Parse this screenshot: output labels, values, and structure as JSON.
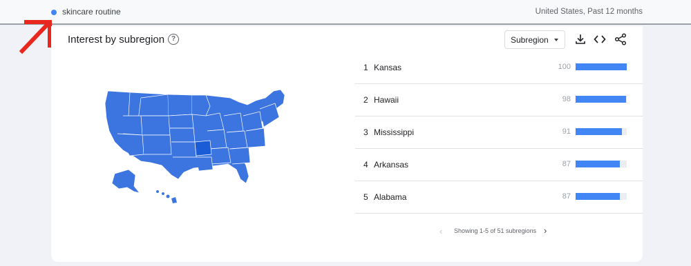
{
  "header": {
    "term": "skincare routine",
    "filters": "United States, Past 12 months",
    "term_color": "#4285f4"
  },
  "card": {
    "title": "Interest by subregion",
    "resolution_select": "Subregion",
    "icons": [
      "help-icon",
      "download-icon",
      "embed-icon",
      "share-icon"
    ]
  },
  "rankings": [
    {
      "rank": "1",
      "name": "Kansas",
      "value": "100",
      "fill": 1.0
    },
    {
      "rank": "2",
      "name": "Hawaii",
      "value": "98",
      "fill": 0.98
    },
    {
      "rank": "3",
      "name": "Mississippi",
      "value": "91",
      "fill": 0.91
    },
    {
      "rank": "4",
      "name": "Arkansas",
      "value": "87",
      "fill": 0.87
    },
    {
      "rank": "5",
      "name": "Alabama",
      "value": "87",
      "fill": 0.87
    }
  ],
  "pagination": {
    "text": "Showing 1-5 of 51 subregions"
  },
  "colors": {
    "accent": "#4285f4",
    "map_fill": "#3d75e0",
    "map_highlight": "#1a5bd6",
    "annotation_arrow": "#e8281f"
  }
}
